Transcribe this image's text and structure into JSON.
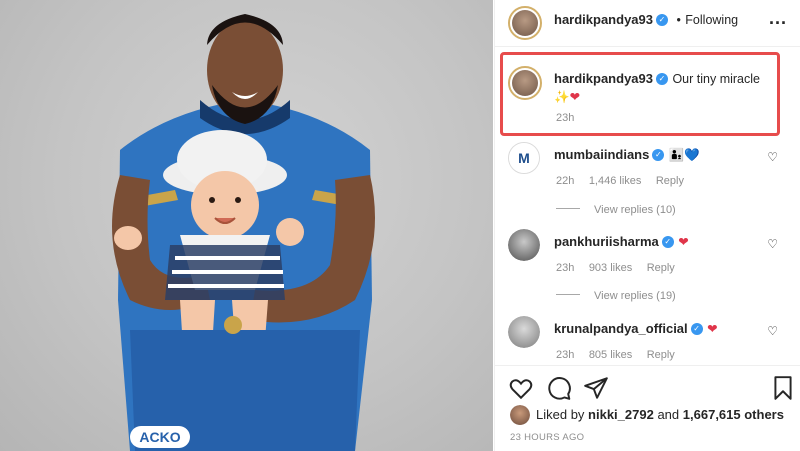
{
  "header": {
    "username": "hardikpandya93",
    "separator": "•",
    "follow_status": "Following",
    "more": "..."
  },
  "caption": {
    "username": "hardikpandya93",
    "text": "Our tiny miracle",
    "emoji": "✨❤",
    "time": "23h"
  },
  "comments": [
    {
      "username": "mumbaiindians",
      "emoji": "👨‍👦💙",
      "time": "22h",
      "likes": "1,446 likes",
      "reply": "Reply",
      "view_replies": "View replies (10)"
    },
    {
      "username": "pankhuriisharma",
      "emoji": "❤",
      "time": "23h",
      "likes": "903 likes",
      "reply": "Reply",
      "view_replies": "View replies (19)"
    },
    {
      "username": "krunalpandya_official",
      "emoji": "❤",
      "time": "23h",
      "likes": "805 likes",
      "reply": "Reply"
    }
  ],
  "likes_line": {
    "prefix": "Liked by",
    "user": "nikki_2792",
    "middle": "and",
    "count": "1,667,615 others"
  },
  "timestamp": "23 HOURS AGO",
  "photo": {
    "jersey_text": "ACKO"
  },
  "colors": {
    "verified": "#3897f0",
    "highlight": "#e74c4c",
    "heart": "#ed4956"
  },
  "icons": [
    "heart-icon",
    "comment-icon",
    "share-icon",
    "bookmark-icon",
    "more-icon",
    "verified-icon"
  ]
}
